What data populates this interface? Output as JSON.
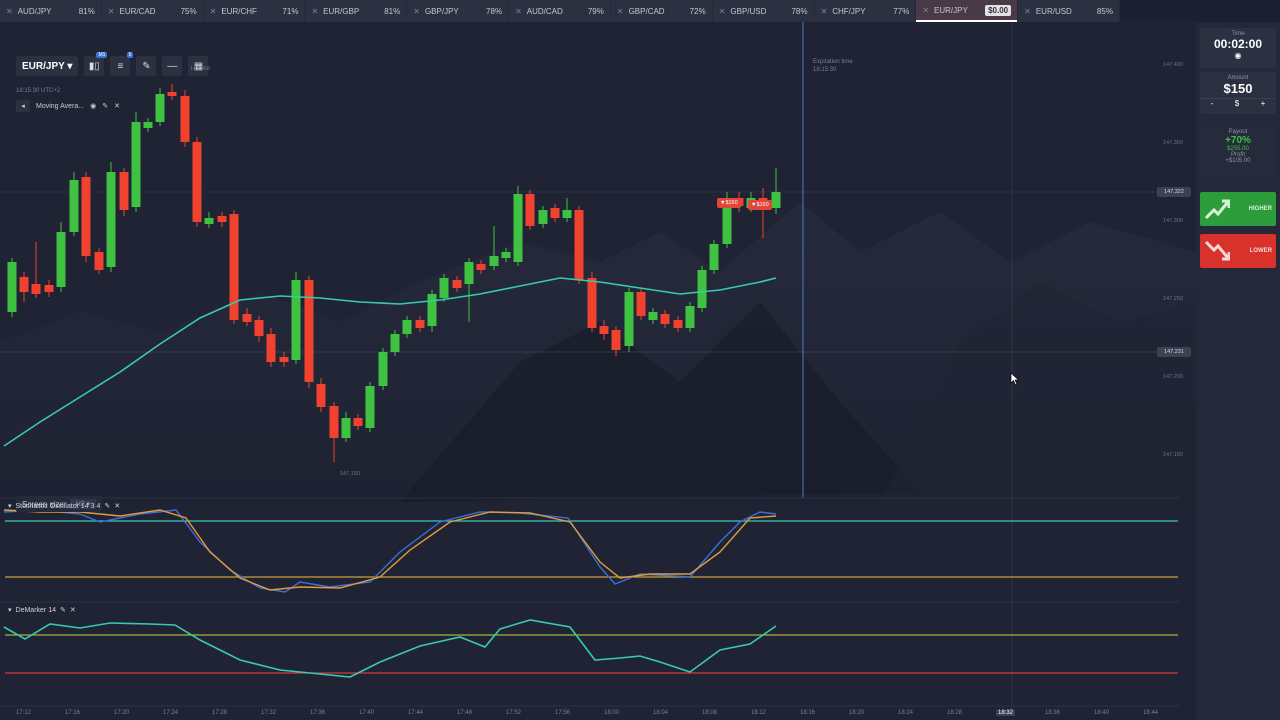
{
  "tabs": [
    {
      "pair": "AUD/JPY",
      "pct": "81%"
    },
    {
      "pair": "EUR/CAD",
      "pct": "75%"
    },
    {
      "pair": "EUR/CHF",
      "pct": "71%"
    },
    {
      "pair": "EUR/GBP",
      "pct": "81%"
    },
    {
      "pair": "GBP/JPY",
      "pct": "78%"
    },
    {
      "pair": "AUD/CAD",
      "pct": "79%"
    },
    {
      "pair": "GBP/CAD",
      "pct": "72%"
    },
    {
      "pair": "GBP/USD",
      "pct": "78%"
    },
    {
      "pair": "CHF/JPY",
      "pct": "77%"
    },
    {
      "pair": "EUR/JPY",
      "pct": "$0.00",
      "active": true
    },
    {
      "pair": "EUR/USD",
      "pct": "85%"
    }
  ],
  "toolbar": {
    "pair": "EUR/JPY ▾",
    "badge1": "M1",
    "badge2": "5"
  },
  "utc": "18:15:30 UTC+2",
  "indicator": {
    "label": "Moving Avera..."
  },
  "screen_size": {
    "label": "Screen size",
    "value": "H2 ▾"
  },
  "expiration": {
    "label": "Expiration time",
    "time": "18:15:30"
  },
  "stochastic": {
    "label": "Stochastic Oscillator 14 3 4"
  },
  "demarker": {
    "label": "DeMarker 14"
  },
  "sidebar": {
    "time_caption": "Time",
    "time_value": "00:02:00",
    "amount_caption": "Amount",
    "amount_value": "$150",
    "amount_minus": "-",
    "amount_dollar": "$",
    "amount_plus": "+",
    "payout_caption": "Payout",
    "payout_pct": "+70%",
    "payout_amount": "$255.00",
    "profit_caption": "Profit",
    "profit_value": "+$105.00",
    "higher_label": "HIGHER",
    "lower_label": "LOWER"
  },
  "price_axis": [
    "147.400",
    "147.350",
    "147.300",
    "147.250",
    "147.200",
    "147.150"
  ],
  "price_tags": {
    "current": "147.322",
    "cursor": "147.231"
  },
  "chart_labels": {
    "high": "147.368",
    "low": "147.150"
  },
  "time_axis": [
    "17:12",
    "17:16",
    "17:20",
    "17:24",
    "17:28",
    "17:32",
    "17:36",
    "17:40",
    "17:44",
    "17:48",
    "17:52",
    "17:56",
    "18:00",
    "18:04",
    "18:08",
    "18:12",
    "18:16",
    "18:20",
    "18:24",
    "18:28",
    "18:32",
    "18:36",
    "18:40",
    "18:44"
  ],
  "trades": [
    "▼$150",
    "▼$150"
  ],
  "colors": {
    "up": "#3fc241",
    "down": "#f0422e",
    "ma": "#38c9b4",
    "stoch_k": "#3b6fd8",
    "stoch_d": "#e39b3c",
    "demarker": "#38c9b4"
  }
}
